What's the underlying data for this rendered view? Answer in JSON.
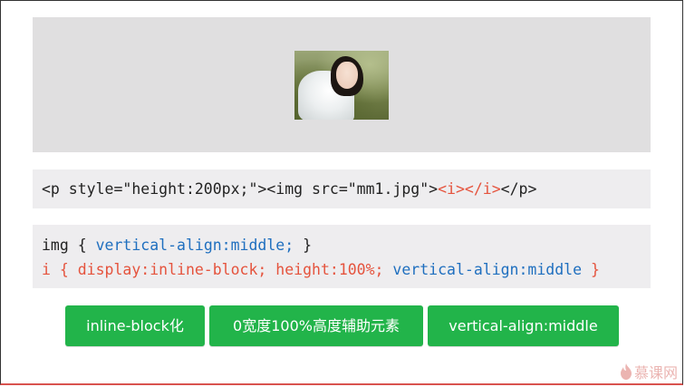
{
  "demo": {
    "image_alt": "mm1.jpg"
  },
  "html_snippet": {
    "part1": "<p style=\"height:200px;\"><img src=\"mm1.jpg\">",
    "part2": "<i></i>",
    "part3": "</p>"
  },
  "css_snippet": {
    "line1_selector": "img { ",
    "line1_rule": "vertical-align:middle;",
    "line1_close": " }",
    "line2_rule": "i { display:inline-block; height:100%; ",
    "line2_rule_blue": "vertical-align:middle",
    "line2_close": " }"
  },
  "buttons": [
    {
      "label": "inline-block化"
    },
    {
      "label": "0宽度100%高度辅助元素"
    },
    {
      "label": "vertical-align:middle"
    }
  ],
  "watermark": {
    "text": "慕课网",
    "icon": "flame-icon"
  },
  "colors": {
    "button_green": "#22b44a",
    "code_blue": "#1f6fbf",
    "code_red": "#e5533d",
    "demo_bg": "#e0dfe0",
    "code_bg": "#eeedef"
  }
}
